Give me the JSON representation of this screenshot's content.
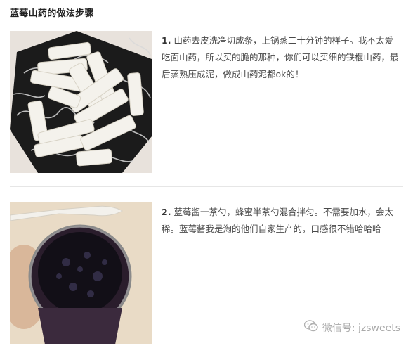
{
  "title": "蓝莓山药的做法步骤",
  "steps": [
    {
      "number": "1.",
      "text": "山药去皮洗净切成条，上锅蒸二十分钟的样子。我不太爱吃面山药，所以买的脆的那种，你们可以买细的铁棍山药，最后蒸熟压成泥，做成山药泥都ok的！",
      "photo": "yam-sticks-photo"
    },
    {
      "number": "2.",
      "text": "蓝莓酱一茶勺，蜂蜜半茶勺混合拌匀。不需要加水，会太稀。蓝莓酱我是淘的他们自家生产的，口感很不错哈哈哈",
      "photo": "blueberry-jam-jar-photo"
    }
  ],
  "watermark": {
    "label": "微信号: jzsweets",
    "icon": "wechat-icon"
  },
  "colors": {
    "title": "#222222",
    "body_text": "#4a4a4a",
    "divider": "#e6e6e6",
    "watermark": "#a9a9a9"
  }
}
